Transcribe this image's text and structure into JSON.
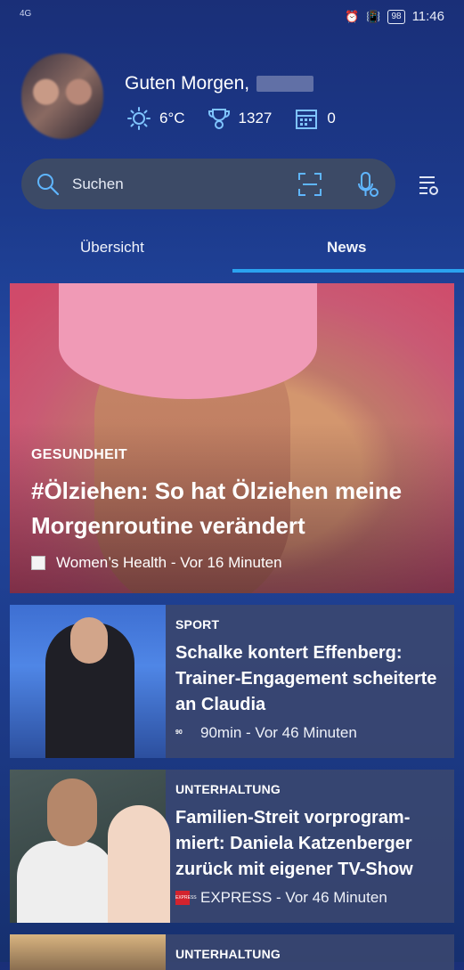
{
  "status_bar": {
    "network": "4G",
    "battery": "98",
    "time": "11:46"
  },
  "header": {
    "greeting": "Guten Morgen,",
    "weather": "6°C",
    "points": "1327",
    "calendar_count": "0"
  },
  "search": {
    "placeholder": "Suchen"
  },
  "tabs": [
    {
      "label": "Übersicht",
      "active": false
    },
    {
      "label": "News",
      "active": true
    }
  ],
  "hero": {
    "category": "GESUNDHEIT",
    "title": "#Ölziehen: So hat Ölziehen meine Morgenroutine verändert",
    "source": "Women’s Health",
    "time": "Vor 16 Minuten"
  },
  "articles": [
    {
      "category": "SPORT",
      "title": "Schalke kontert Effenberg: Trainer-Engagement scheiterte an Claudia",
      "source": "90min",
      "time": "Vor 46 Minuten",
      "source_logo_text": "90"
    },
    {
      "category": "UNTERHALTUNG",
      "title": "Familien-Streit vorprogram-miert: Daniela Katzenberger zurück mit eigener TV-Show",
      "source": "EXPRESS",
      "time": "Vor 46 Minuten",
      "source_logo_text": "EXPRESS"
    },
    {
      "category": "UNTERHALTUNG"
    }
  ],
  "colors": {
    "accent": "#2aa3f0",
    "hero_bg": "#d04a6a",
    "search_bg": "#3c4a66"
  }
}
